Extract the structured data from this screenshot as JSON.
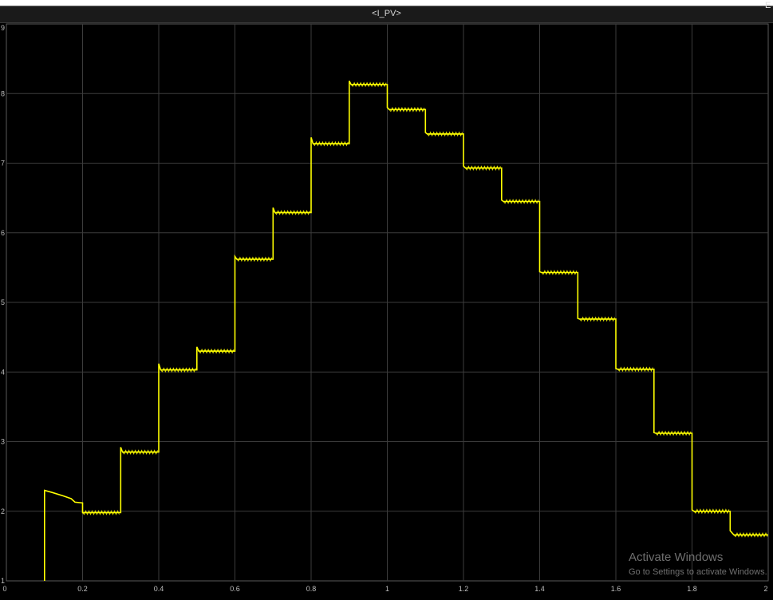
{
  "window": {
    "title": "<I_PV>",
    "corner_label": "E"
  },
  "watermark": {
    "title": "Activate Windows",
    "subtitle": "Go to Settings to activate Windows."
  },
  "colors": {
    "background": "#000000",
    "grid": "#3c3c3c",
    "signal": "#ffff00",
    "tick_text": "#bfbfbf"
  },
  "chart_data": {
    "type": "line",
    "title": "<I_PV>",
    "xlim": [
      0,
      2
    ],
    "ylim": [
      1,
      9
    ],
    "x_ticks": [
      "0",
      "0.2",
      "0.4",
      "0.6",
      "0.8",
      "1",
      "1.2",
      "1.4",
      "1.6",
      "1.8",
      "2"
    ],
    "y_ticks": [
      "1",
      "2",
      "3",
      "4",
      "5",
      "6",
      "7",
      "8",
      "9"
    ],
    "grid": true,
    "series": [
      {
        "color": "#ffff00",
        "x": [
          0.1,
          0.1,
          0.12,
          0.15,
          0.17,
          0.18,
          0.2,
          0.2,
          0.3,
          0.3,
          0.305,
          0.4,
          0.4,
          0.405,
          0.5,
          0.5,
          0.505,
          0.6,
          0.6,
          0.605,
          0.7,
          0.7,
          0.705,
          0.8,
          0.8,
          0.805,
          0.9,
          0.9,
          0.905,
          1.0,
          1.0,
          1.005,
          1.1,
          1.1,
          1.105,
          1.2,
          1.2,
          1.205,
          1.3,
          1.3,
          1.305,
          1.4,
          1.4,
          1.405,
          1.5,
          1.5,
          1.505,
          1.6,
          1.6,
          1.605,
          1.7,
          1.7,
          1.705,
          1.8,
          1.8,
          1.805,
          1.9,
          1.9,
          1.91,
          2.0
        ],
        "y": [
          1.0,
          2.3,
          2.27,
          2.22,
          2.18,
          2.13,
          2.12,
          1.98,
          1.98,
          2.92,
          2.85,
          2.85,
          4.12,
          4.03,
          4.03,
          4.36,
          4.3,
          4.3,
          5.66,
          5.62,
          5.62,
          6.36,
          6.29,
          6.29,
          7.37,
          7.28,
          7.28,
          8.18,
          8.13,
          8.13,
          7.8,
          7.77,
          7.77,
          7.44,
          7.42,
          7.42,
          6.96,
          6.93,
          6.93,
          6.47,
          6.45,
          6.45,
          5.44,
          5.43,
          5.43,
          4.77,
          4.76,
          4.76,
          4.05,
          4.04,
          4.04,
          3.13,
          3.12,
          3.12,
          2.02,
          2.0,
          2.0,
          1.72,
          1.66,
          1.66
        ]
      }
    ]
  }
}
